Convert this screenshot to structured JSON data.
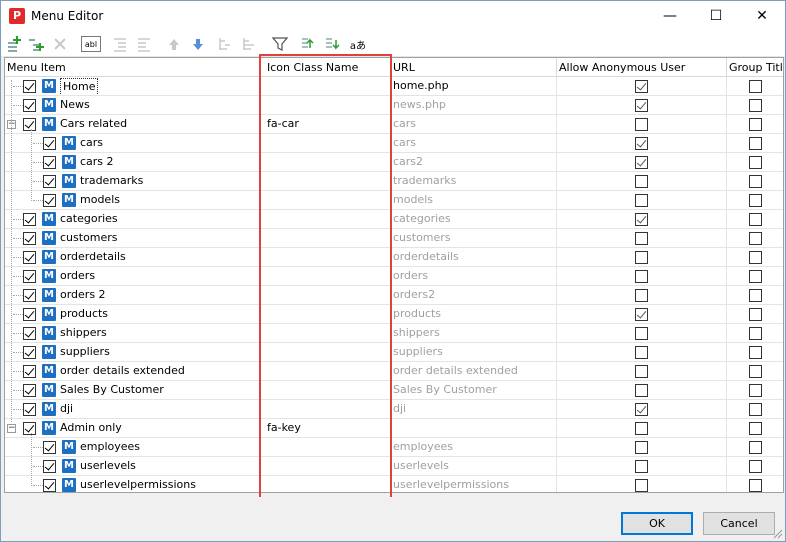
{
  "window": {
    "title": "Menu Editor",
    "app_icon_letter": "P",
    "controls": {
      "minimize": "—",
      "maximize": "☐",
      "close": "✕"
    }
  },
  "toolbar": {
    "buttons": [
      {
        "name": "add-item-icon"
      },
      {
        "name": "add-child-icon"
      },
      {
        "name": "delete-icon"
      },
      {
        "name": "rename-icon",
        "text": "abl"
      },
      {
        "name": "indent-icon"
      },
      {
        "name": "outdent-icon"
      },
      {
        "name": "move-up-icon"
      },
      {
        "name": "move-down-icon"
      },
      {
        "name": "expand-all-icon"
      },
      {
        "name": "collapse-all-icon"
      },
      {
        "name": "filter-icon"
      },
      {
        "name": "import-icon"
      },
      {
        "name": "export-icon"
      },
      {
        "name": "translate-icon",
        "text": "aあ"
      }
    ]
  },
  "grid": {
    "columns": {
      "menu_item": "Menu Item",
      "icon_class": "Icon Class Name",
      "url": "URL",
      "allow_anonymous": "Allow Anonymous User",
      "group_title": "Group Title"
    },
    "rows": [
      {
        "label": "Home",
        "level": 0,
        "checked": true,
        "icon_class": "",
        "url": "home.php",
        "url_active": true,
        "anon": true,
        "group": false,
        "selected": true
      },
      {
        "label": "News",
        "level": 0,
        "checked": true,
        "icon_class": "",
        "url": "news.php",
        "url_active": false,
        "anon": true,
        "group": false
      },
      {
        "label": "Cars related",
        "level": 0,
        "checked": true,
        "icon_class": "fa-car",
        "url": "cars",
        "url_active": false,
        "anon": false,
        "group": false,
        "expander": "−"
      },
      {
        "label": "cars",
        "level": 1,
        "checked": true,
        "icon_class": "",
        "url": "cars",
        "url_active": false,
        "anon": true,
        "group": false
      },
      {
        "label": "cars 2",
        "level": 1,
        "checked": true,
        "icon_class": "",
        "url": "cars2",
        "url_active": false,
        "anon": true,
        "group": false
      },
      {
        "label": "trademarks",
        "level": 1,
        "checked": true,
        "icon_class": "",
        "url": "trademarks",
        "url_active": false,
        "anon": false,
        "group": false
      },
      {
        "label": "models",
        "level": 1,
        "checked": true,
        "icon_class": "",
        "url": "models",
        "url_active": false,
        "anon": false,
        "group": false
      },
      {
        "label": "categories",
        "level": 0,
        "checked": true,
        "icon_class": "",
        "url": "categories",
        "url_active": false,
        "anon": true,
        "group": false
      },
      {
        "label": "customers",
        "level": 0,
        "checked": true,
        "icon_class": "",
        "url": "customers",
        "url_active": false,
        "anon": false,
        "group": false
      },
      {
        "label": "orderdetails",
        "level": 0,
        "checked": true,
        "icon_class": "",
        "url": "orderdetails",
        "url_active": false,
        "anon": false,
        "group": false
      },
      {
        "label": "orders",
        "level": 0,
        "checked": true,
        "icon_class": "",
        "url": "orders",
        "url_active": false,
        "anon": false,
        "group": false
      },
      {
        "label": "orders 2",
        "level": 0,
        "checked": true,
        "icon_class": "",
        "url": "orders2",
        "url_active": false,
        "anon": false,
        "group": false
      },
      {
        "label": "products",
        "level": 0,
        "checked": true,
        "icon_class": "",
        "url": "products",
        "url_active": false,
        "anon": true,
        "group": false
      },
      {
        "label": "shippers",
        "level": 0,
        "checked": true,
        "icon_class": "",
        "url": "shippers",
        "url_active": false,
        "anon": false,
        "group": false
      },
      {
        "label": "suppliers",
        "level": 0,
        "checked": true,
        "icon_class": "",
        "url": "suppliers",
        "url_active": false,
        "anon": false,
        "group": false
      },
      {
        "label": "order details extended",
        "level": 0,
        "checked": true,
        "icon_class": "",
        "url": "order details extended",
        "url_active": false,
        "anon": false,
        "group": false
      },
      {
        "label": "Sales By Customer",
        "level": 0,
        "checked": true,
        "icon_class": "",
        "url": "Sales By Customer",
        "url_active": false,
        "anon": false,
        "group": false
      },
      {
        "label": "dji",
        "level": 0,
        "checked": true,
        "icon_class": "",
        "url": "dji",
        "url_active": false,
        "anon": true,
        "group": false
      },
      {
        "label": "Admin only",
        "level": 0,
        "checked": true,
        "icon_class": "fa-key",
        "url": "",
        "url_active": false,
        "anon": false,
        "group": false,
        "expander": "−"
      },
      {
        "label": "employees",
        "level": 1,
        "checked": true,
        "icon_class": "",
        "url": "employees",
        "url_active": false,
        "anon": false,
        "group": false
      },
      {
        "label": "userlevels",
        "level": 1,
        "checked": true,
        "icon_class": "",
        "url": "userlevels",
        "url_active": false,
        "anon": false,
        "group": false
      },
      {
        "label": "userlevelpermissions",
        "level": 1,
        "checked": true,
        "icon_class": "",
        "url": "userlevelpermissions",
        "url_active": false,
        "anon": false,
        "group": false
      }
    ]
  },
  "buttons": {
    "ok": "OK",
    "cancel": "Cancel"
  },
  "colors": {
    "highlight": "#e04040",
    "menu_icon": "#1d6fc2",
    "disabled_url": "#a0a0a0"
  }
}
